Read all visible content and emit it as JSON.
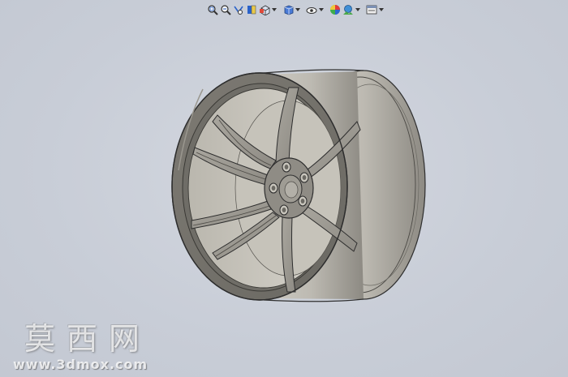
{
  "toolbar": {
    "items": [
      {
        "name": "zoom-to-fit-icon",
        "dropdown": false
      },
      {
        "name": "zoom-to-area-icon",
        "dropdown": false
      },
      {
        "name": "previous-view-icon",
        "dropdown": false
      },
      {
        "name": "section-view-icon",
        "dropdown": false
      },
      {
        "name": "view-orientation-icon",
        "dropdown": true
      },
      {
        "name": "display-style-icon",
        "dropdown": true
      },
      {
        "name": "hide-show-items-icon",
        "dropdown": true
      },
      {
        "name": "edit-appearance-icon",
        "dropdown": false
      },
      {
        "name": "apply-scene-icon",
        "dropdown": true
      },
      {
        "name": "view-settings-icon",
        "dropdown": true
      }
    ]
  },
  "colors": {
    "background": "#c9ced8",
    "model": "#8a8780",
    "model_light": "#b5b2aa",
    "model_dark": "#5c5a55",
    "edge": "#2e2e2e"
  },
  "watermark": {
    "chinese": "莫西网",
    "url": "www.3dmox.com"
  }
}
